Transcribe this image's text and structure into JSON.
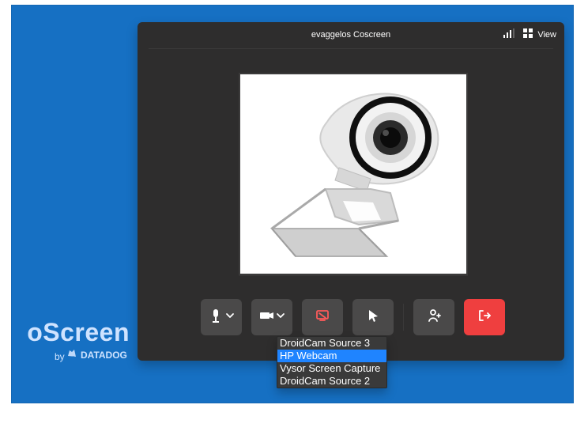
{
  "branding": {
    "name": "oScreen",
    "by": "by",
    "company": "DATADOG"
  },
  "window": {
    "title": "evaggelos Coscreen",
    "view_label": "View"
  },
  "controls": {
    "items": [
      "mic",
      "camera",
      "screen-share",
      "pointer",
      "add-user",
      "leave"
    ]
  },
  "camera_menu": {
    "items": [
      {
        "label": "DroidCam Source 3",
        "selected": false
      },
      {
        "label": "HP Webcam",
        "selected": true
      },
      {
        "label": "Vysor Screen Capture",
        "selected": false
      },
      {
        "label": "DroidCam Source 2",
        "selected": false
      }
    ]
  },
  "colors": {
    "desktop_blue": "#1670c3",
    "window_bg": "#2e2d2d",
    "control_bg": "#4a4949",
    "leave_red": "#ef3f3f",
    "selected_blue": "#1f84ff"
  }
}
